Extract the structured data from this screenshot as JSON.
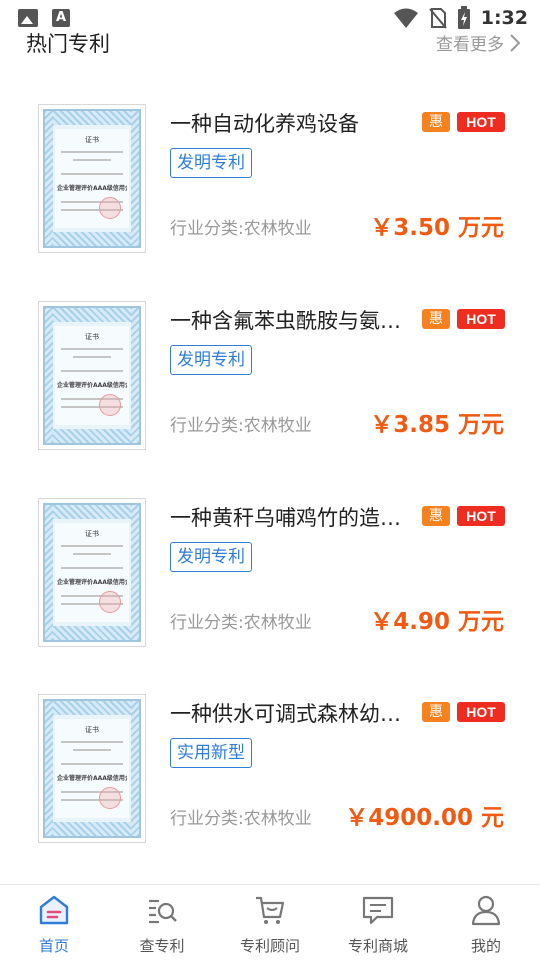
{
  "status_bar": {
    "time": "1:32"
  },
  "section": {
    "title": "热门专利",
    "see_more": "查看更多"
  },
  "patents": [
    {
      "title": "一种自动化养鸡设备",
      "badge_hui": "惠",
      "badge_hot": "HOT",
      "type": "发明专利",
      "industry": "行业分类:农林牧业",
      "price": "￥3.50 万元"
    },
    {
      "title": "一种含氟苯虫酰胺与氨基…",
      "badge_hui": "惠",
      "badge_hot": "HOT",
      "type": "发明专利",
      "industry": "行业分类:农林牧业",
      "price": "￥3.85 万元"
    },
    {
      "title": "一种黄秆乌哺鸡竹的造林…",
      "badge_hui": "惠",
      "badge_hot": "HOT",
      "type": "发明专利",
      "industry": "行业分类:农林牧业",
      "price": "￥4.90 万元"
    },
    {
      "title": "一种供水可调式森林幼苗…",
      "badge_hui": "惠",
      "badge_hot": "HOT",
      "type": "实用新型",
      "industry": "行业分类:农林牧业",
      "price": "￥4900.00 元"
    }
  ],
  "certificate": {
    "heading": "证书",
    "main_text": "企业管理评价AAA级信用企业"
  },
  "tabs": [
    {
      "label": "首页",
      "icon": "home-icon",
      "active": true
    },
    {
      "label": "查专利",
      "icon": "search-list-icon",
      "active": false
    },
    {
      "label": "专利顾问",
      "icon": "cart-icon",
      "active": false
    },
    {
      "label": "专利商城",
      "icon": "chat-icon",
      "active": false
    },
    {
      "label": "我的",
      "icon": "user-icon",
      "active": false
    }
  ],
  "colors": {
    "accent": "#2f7dd9",
    "price": "#f05a12",
    "hot": "#ee2c1f",
    "hui": "#f5821f"
  }
}
